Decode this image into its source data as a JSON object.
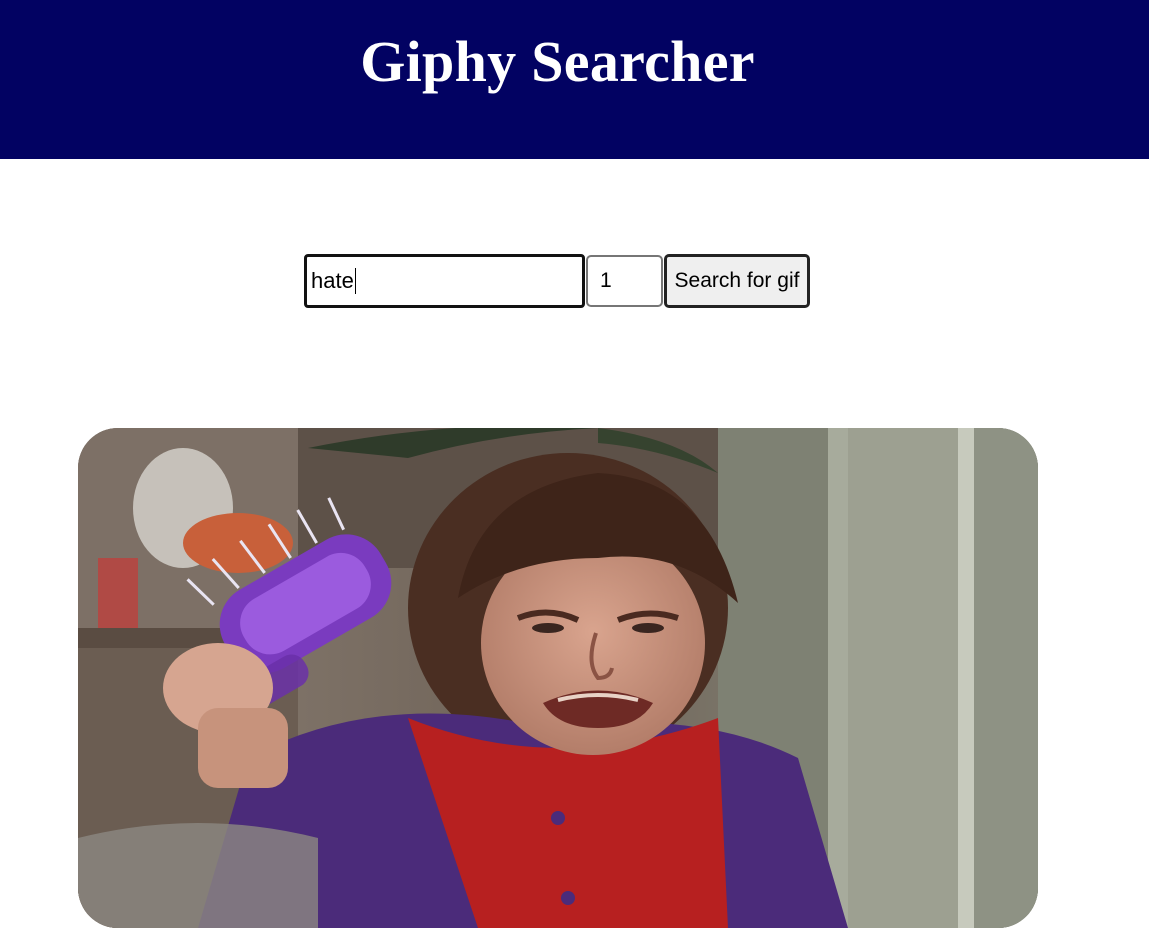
{
  "header": {
    "title": "Giphy Searcher",
    "background_color": "#020262"
  },
  "search": {
    "query_value": "hate",
    "count_value": "1",
    "button_label": "Search for gif"
  },
  "result": {
    "image_kind": "animated gif of an angry girl holding a purple hairbrush"
  }
}
